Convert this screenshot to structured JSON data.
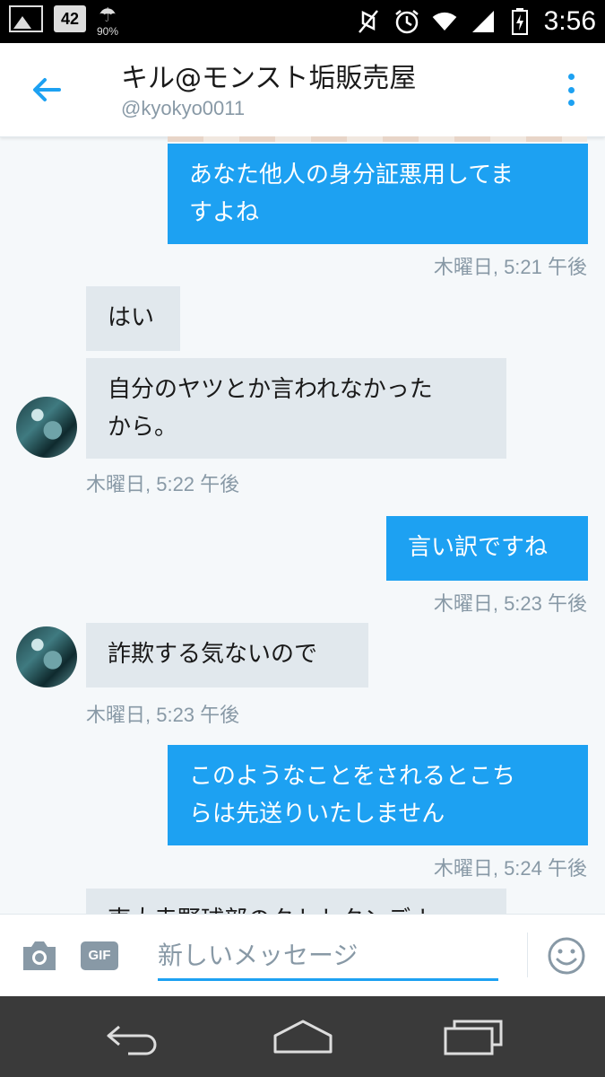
{
  "status_bar": {
    "rain_percent": "90%",
    "badge_label": "42",
    "time": "3:56"
  },
  "header": {
    "title": "キル@モンスト垢販売屋",
    "handle": "@kyokyo0011"
  },
  "messages": [
    {
      "direction": "outgoing",
      "lines": [
        "あなた他人の身分証悪用してま",
        "すよね"
      ],
      "timestamp": "木曜日, 5:21 午後"
    },
    {
      "direction": "incoming",
      "lines": [
        "はい"
      ]
    },
    {
      "direction": "incoming",
      "lines": [
        "自分のヤツとか言われなかった",
        "から。"
      ],
      "timestamp": "木曜日, 5:22 午後"
    },
    {
      "direction": "outgoing",
      "lines": [
        "言い訳ですね"
      ],
      "timestamp": "木曜日, 5:23 午後"
    },
    {
      "direction": "incoming",
      "lines": [
        "詐欺する気ないので"
      ],
      "timestamp": "木曜日, 5:23 午後"
    },
    {
      "direction": "outgoing",
      "lines": [
        "このようなことをされるとこち",
        "らは先送りいたしません"
      ],
      "timestamp": "木曜日, 5:24 午後"
    },
    {
      "direction": "incoming",
      "lines": [
        "東大寺野球部のクトトクンデナ"
      ]
    }
  ],
  "composer": {
    "gif_label": "GIF",
    "placeholder": "新しいメッセージ"
  },
  "colors": {
    "accent": "#1da1f2",
    "incoming_bubble": "#e1e8ed",
    "timestamp": "#8899a6"
  },
  "icons": [
    "photo-icon",
    "badge-icon",
    "umbrella-icon",
    "mute-icon",
    "alarm-icon",
    "wifi-icon",
    "signal-icon",
    "battery-icon",
    "back-arrow-icon",
    "overflow-menu-icon",
    "camera-icon",
    "gif-icon",
    "emoji-icon",
    "nav-back-icon",
    "nav-home-icon",
    "nav-recents-icon"
  ]
}
